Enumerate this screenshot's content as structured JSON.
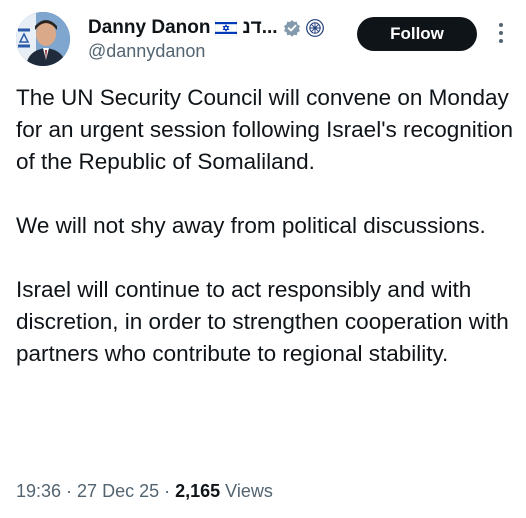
{
  "author": {
    "display_name": "Danny Danon",
    "hebrew_name": "דנ...",
    "handle": "@dannydanon",
    "flag_icon": "israel-flag-icon",
    "badge_icon": "verified-badge-icon",
    "affiliation_icon": "organization-emblem-icon"
  },
  "follow_label": "Follow",
  "more_icon": "vertical-ellipsis-icon",
  "tweet": {
    "paragraphs": [
      "The UN Security Council will convene on Monday for an urgent session following Israel's recognition of the Republic of Somaliland.",
      "We will not shy away from political discussions.",
      "Israel will continue to act responsibly and with discretion, in order to strengthen cooperation with partners who contribute to regional stability."
    ]
  },
  "meta": {
    "time": "19:36",
    "separator": " · ",
    "date": "27 Dec 25",
    "views_count": "2,165",
    "views_label": " Views"
  },
  "colors": {
    "text": "#0f1419",
    "secondary": "#536471",
    "button_bg": "#0f1419",
    "verified_gray": "#829aab",
    "flag_blue": "#0038b8"
  }
}
